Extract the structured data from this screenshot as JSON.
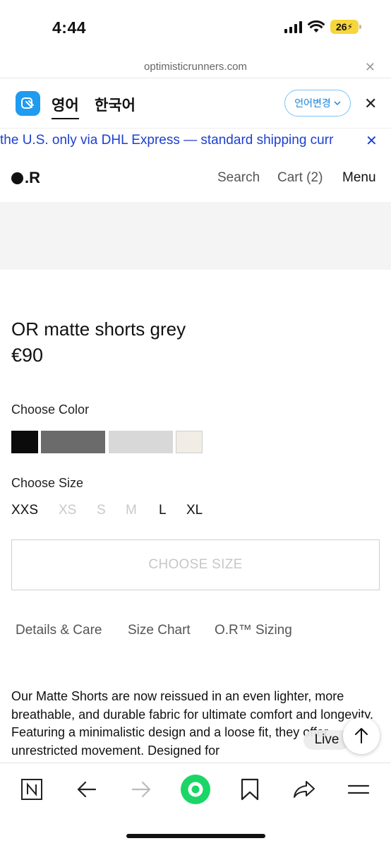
{
  "status": {
    "time": "4:44",
    "battery": "26"
  },
  "browser": {
    "url": "optimisticrunners.com"
  },
  "translate": {
    "lang_active": "영어",
    "lang_other": "한국어",
    "change_label": "언어변경"
  },
  "banner": {
    "text": "the U.S. only via DHL Express — standard shipping curr"
  },
  "header": {
    "logo_text": ".R",
    "search": "Search",
    "cart": "Cart (2)",
    "menu": "Menu"
  },
  "product": {
    "title": "OR matte shorts grey",
    "price": "€90",
    "color_label": "Choose Color",
    "colors": [
      "#0b0b0b",
      "#6b6b6b",
      "#d8d8d8",
      "#f1ede4"
    ],
    "size_label": "Choose Size",
    "sizes": [
      {
        "label": "XXS",
        "available": true
      },
      {
        "label": "XS",
        "available": false
      },
      {
        "label": "S",
        "available": false
      },
      {
        "label": "M",
        "available": false
      },
      {
        "label": "L",
        "available": true
      },
      {
        "label": "XL",
        "available": true
      }
    ],
    "choose_size_button": "CHOOSE SIZE",
    "tabs": [
      "Details & Care",
      "Size Chart",
      "O.R™ Sizing"
    ],
    "description": "Our Matte Shorts are now reissued in an even lighter, more breathable, and durable fabric for ultimate comfort and longevity. Featuring a minimalistic design and a loose fit, they offer unrestricted movement. Designed for"
  },
  "live_label": "Live"
}
